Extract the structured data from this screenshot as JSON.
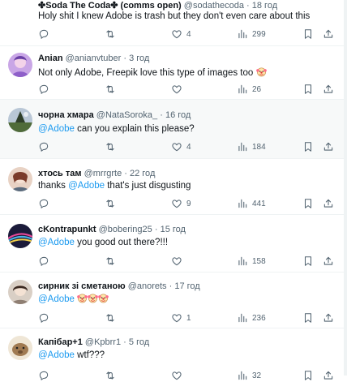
{
  "tweets": [
    {
      "name": "✤Soda The Coda✤ (comms open)",
      "handle": "@sodathecoda",
      "time": "18 год",
      "text": "Holy shit I knew Adobe is trash but they don't even care about this",
      "likes": "4",
      "views": "299"
    },
    {
      "name": "Anian",
      "handle": "@anianvtuber",
      "time": "3 год",
      "text": "Not only Adobe, Freepik love this type of images too",
      "likes": "",
      "views": "26"
    },
    {
      "name": "чорна хмара",
      "handle": "@NataSoroka_",
      "time": "16 год",
      "mention": "@Adobe",
      "text": "can you explain this please?",
      "likes": "4",
      "views": "184"
    },
    {
      "name": "хтось там",
      "handle": "@mrrgrte",
      "time": "22 год",
      "pre": "thanks",
      "mention": "@Adobe",
      "text": "that's just disgusting",
      "likes": "9",
      "views": "441"
    },
    {
      "name": "cKontrapunkt",
      "handle": "@bobering25",
      "time": "15 год",
      "mention": "@Adobe",
      "text": "you good out there?!!!",
      "likes": "",
      "views": "158"
    },
    {
      "name": "сирник зі сметаною",
      "handle": "@anorets",
      "time": "17 год",
      "mention": "@Adobe",
      "text": "",
      "likes": "1",
      "views": "236"
    },
    {
      "name": "Капібар+1",
      "handle": "@Kpbrr1",
      "time": "5 год",
      "mention": "@Adobe",
      "text": "wtf???",
      "likes": "",
      "views": "32"
    }
  ],
  "sep": "·",
  "icons": {
    "reply": "reply-icon",
    "retweet": "retweet-icon",
    "like": "heart-icon",
    "views": "views-chart-icon",
    "bookmark": "bookmark-icon",
    "share": "share-icon",
    "emoji": "clown-emoji"
  },
  "colors": {
    "mention": "#1d9bf0",
    "meta": "#536471",
    "highlight": "#f7f9f9"
  }
}
